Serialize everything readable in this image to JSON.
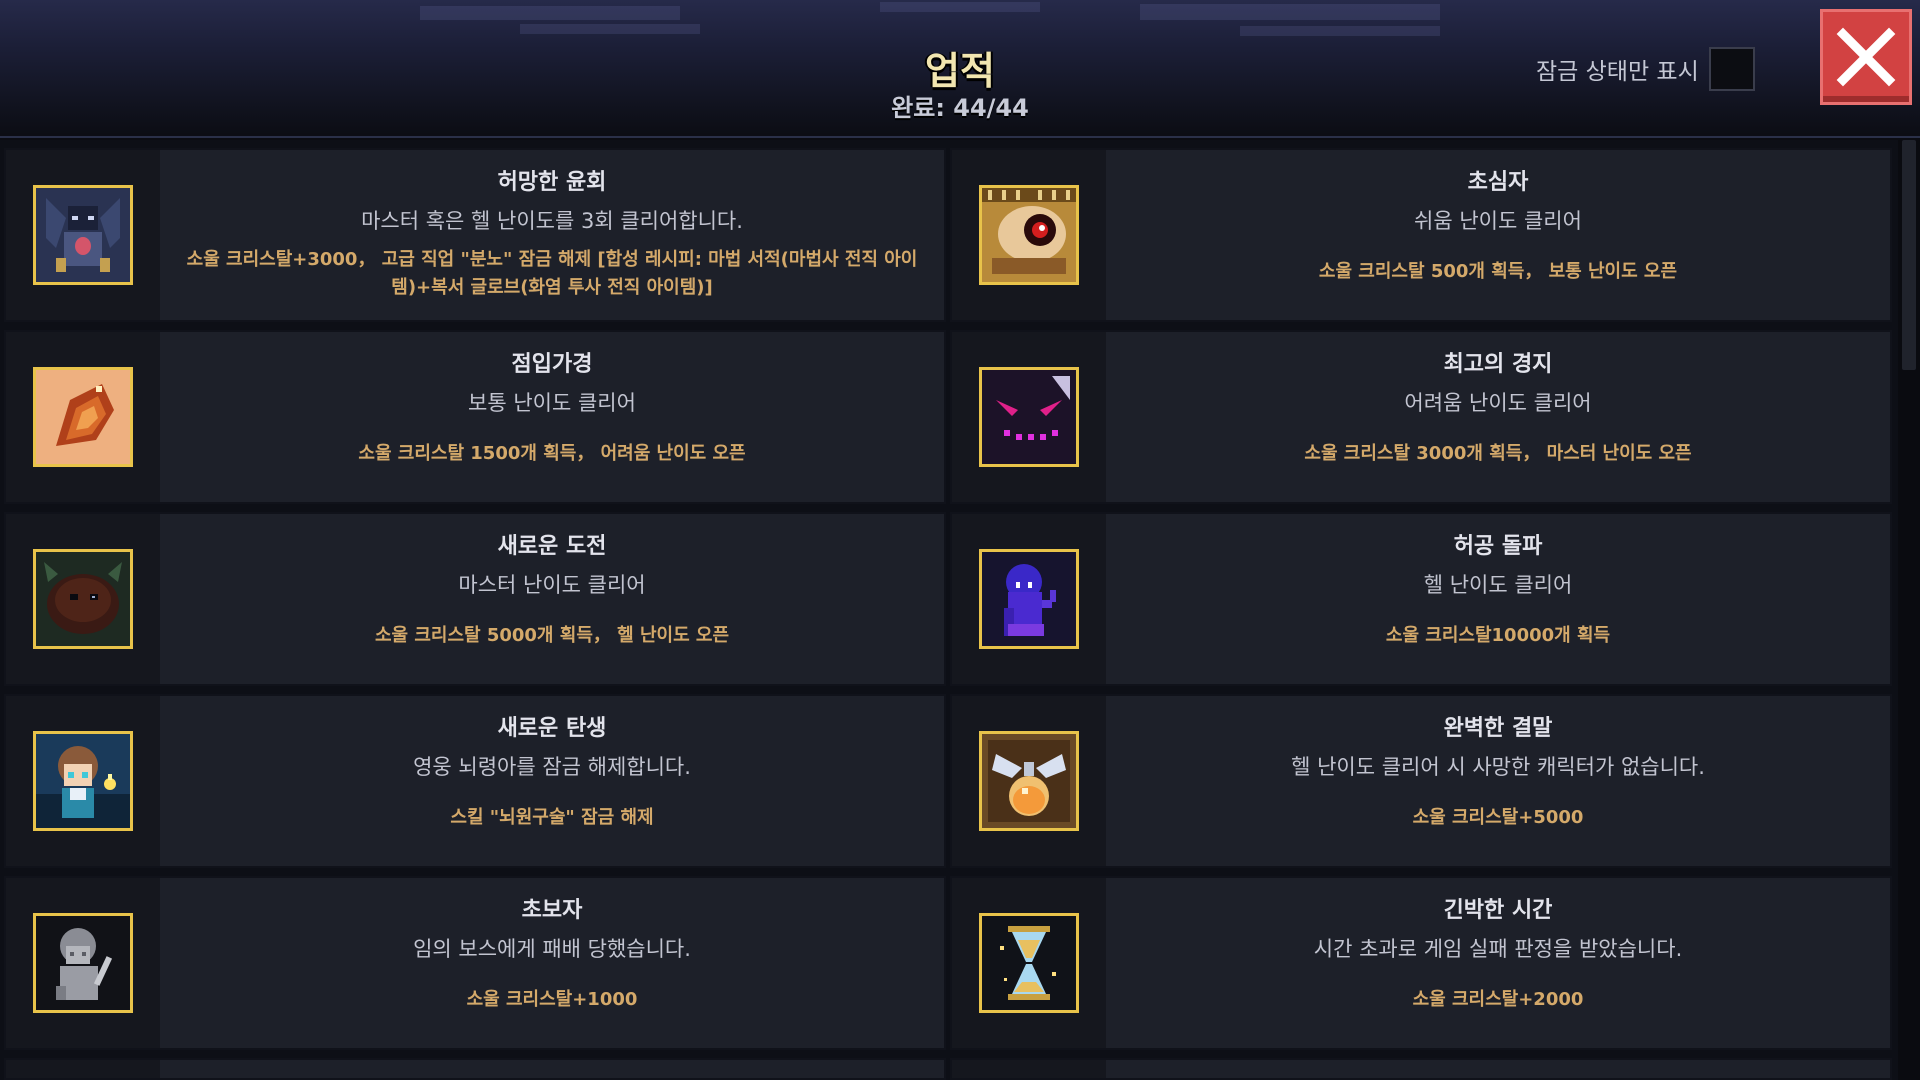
{
  "header": {
    "title": "업적",
    "progress": "완료: 44/44",
    "lock_filter_label": "잠금 상태만 표시",
    "lock_filter_checked": false,
    "close_icon": "close-x-icon"
  },
  "colors": {
    "title": "#f2e6b0",
    "reward": "#d4a96a",
    "icon_border": "#e8c34a",
    "close_button": "#d24242"
  },
  "achievements": [
    {
      "name": "허망한 윤회",
      "desc": "마스터 혹은 헬 난이도를 3회 클리어합니다.",
      "reward": "소울 크리스탈+3000， 고급 직업 \"분노\" 잠금 해제 [합성 레시피: 마법 서적(마법사 전직 아이템)+복서 글로브(화염 투사 전직 아이템)]",
      "icon": "dark-armored-knight-icon"
    },
    {
      "name": "초심자",
      "desc": "쉬움 난이도 클리어",
      "reward": "소울 크리스탈 500개 획득， 보통 난이도 오픈",
      "icon": "red-eye-beast-icon"
    },
    {
      "name": "점입가경",
      "desc": "보통 난이도 클리어",
      "reward": "소울 크리스탈 1500개 획득， 어려움 난이도 오픈",
      "icon": "flame-claw-icon"
    },
    {
      "name": "최고의 경지",
      "desc": "어려움 난이도 클리어",
      "reward": "소울 크리스탈 3000개 획득， 마스터 난이도 오픈",
      "icon": "shadow-demon-face-icon"
    },
    {
      "name": "새로운 도전",
      "desc": "마스터 난이도 클리어",
      "reward": "소울 크리스탈 5000개 획득， 헬 난이도 오픈",
      "icon": "dark-blob-monster-icon"
    },
    {
      "name": "허공 돌파",
      "desc": "헬 난이도 클리어",
      "reward": "소울 크리스탈10000개 획득",
      "icon": "purple-ghost-figure-icon"
    },
    {
      "name": "새로운 탄생",
      "desc": "영웅 뇌령아를 잠금 해제합니다.",
      "reward": "스킬 \"뇌원구술\" 잠금 해제",
      "icon": "lightning-hero-portrait-icon"
    },
    {
      "name": "완벽한 결말",
      "desc": "헬 난이도 클리어 시 사망한 캐릭터가 없습니다.",
      "reward": "소울 크리스탈+5000",
      "icon": "winged-potion-icon"
    },
    {
      "name": "초보자",
      "desc": "임의 보스에게 패배 당했습니다.",
      "reward": "소울 크리스탈+1000",
      "icon": "grey-knight-statue-icon"
    },
    {
      "name": "긴박한 시간",
      "desc": "시간 초과로 게임 실패 판정을 받았습니다.",
      "reward": "소울 크리스탈+2000",
      "icon": "hourglass-icon"
    }
  ]
}
